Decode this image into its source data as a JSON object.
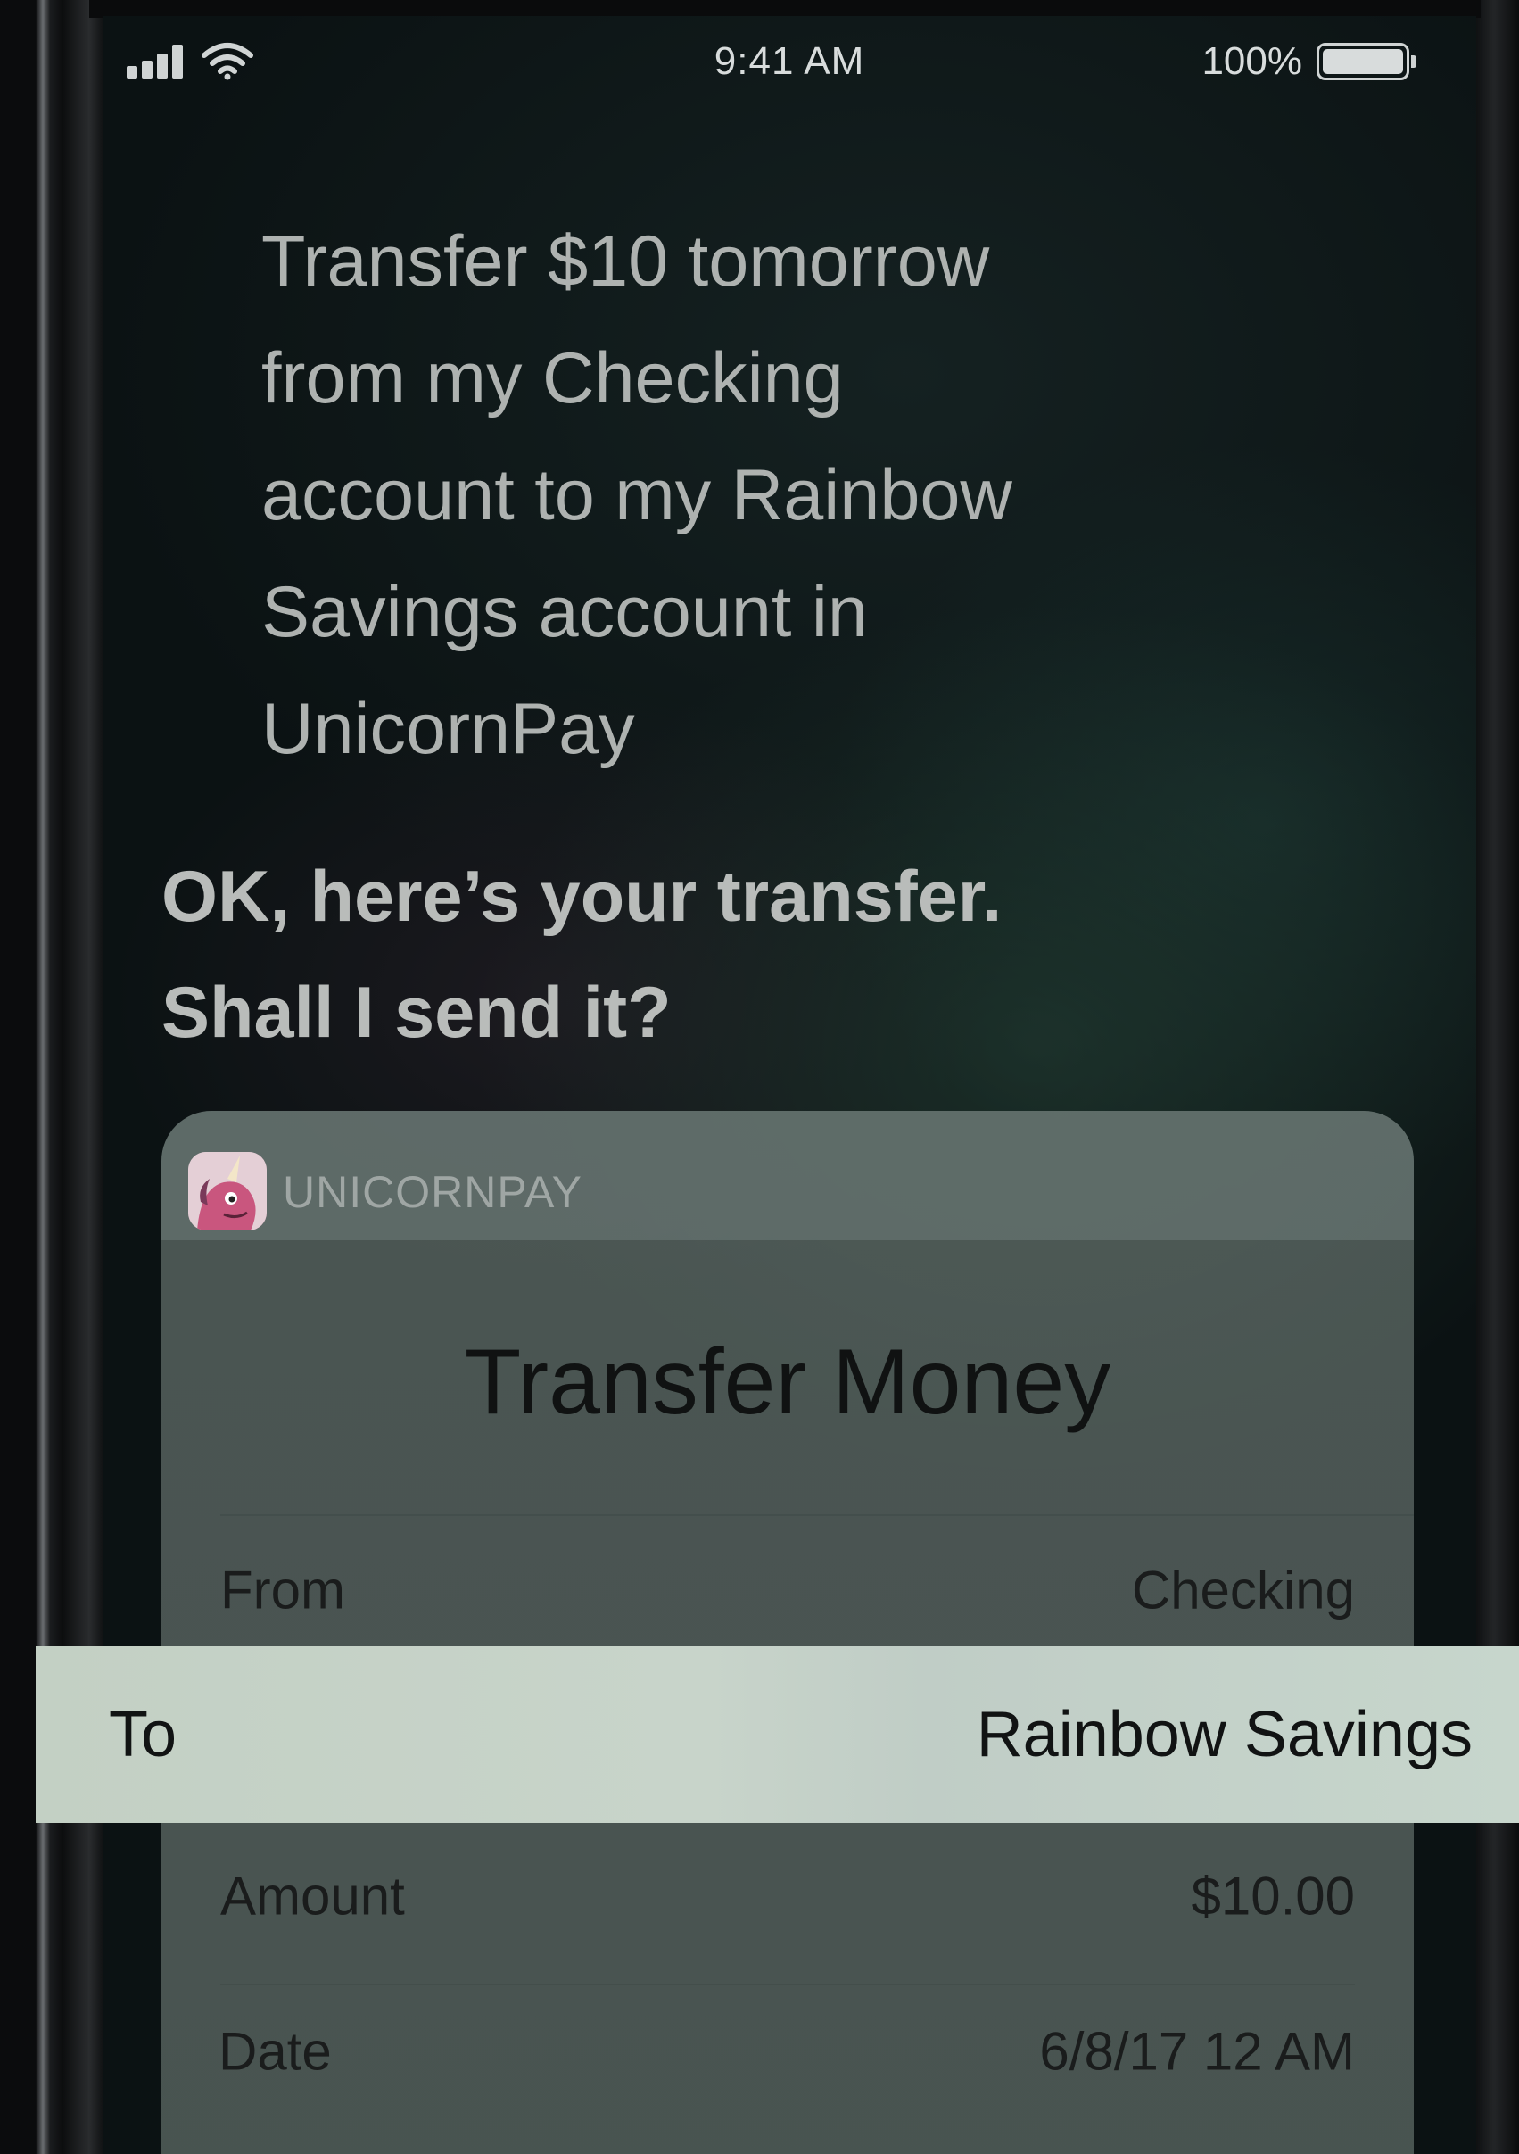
{
  "status_bar": {
    "time": "9:41 AM",
    "battery_percent": "100%",
    "battery_level": 1.0,
    "icons": [
      "signal-bars-icon",
      "wifi-icon",
      "battery-icon"
    ]
  },
  "siri": {
    "utterance_lines": [
      "Transfer $10 tomorrow",
      "from my Checking",
      "account to my Rainbow",
      "Savings account in",
      "UnicornPay"
    ],
    "response_lines": [
      "OK, here’s your transfer.",
      "Shall I send it?"
    ]
  },
  "card": {
    "app_name": "UNICORNPAY",
    "app_icon": "unicorn-app-icon",
    "title": "Transfer Money",
    "rows": [
      {
        "label": "From",
        "value": "Checking"
      },
      {
        "label": "To",
        "value": "Rainbow Savings"
      },
      {
        "label": "Amount",
        "value": "$10.00"
      },
      {
        "label": "Date",
        "value": "6/8/17 12 AM"
      }
    ]
  },
  "colors": {
    "highlight": "#c5d2c8",
    "card": "#5e6a66",
    "siri_text": "#aeb2b0"
  }
}
